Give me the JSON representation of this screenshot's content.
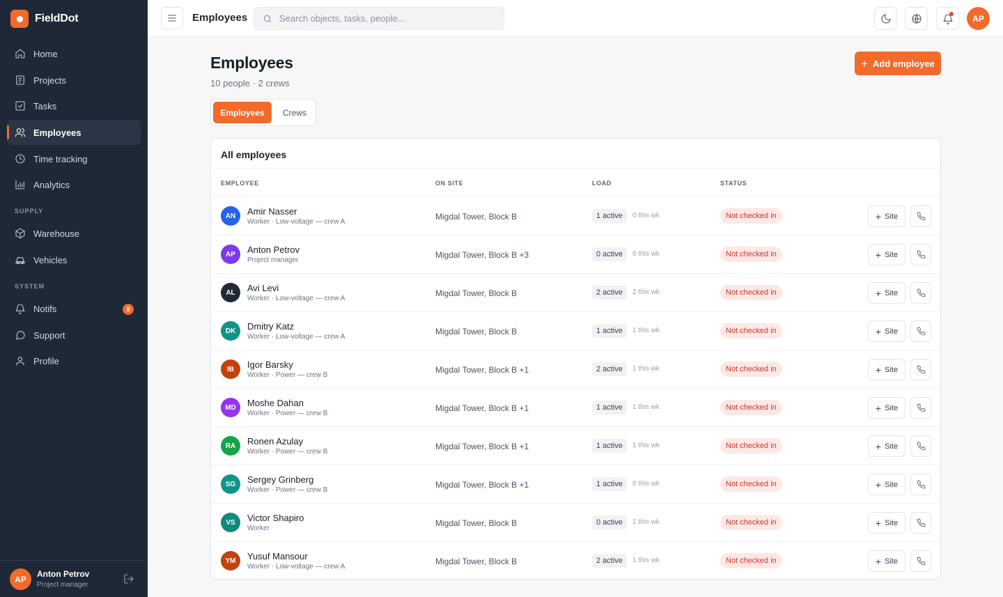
{
  "app": {
    "name": "FieldDot"
  },
  "colors": {
    "accent": "#f26b2b",
    "sidebar_bg": "#1e2836",
    "status_danger_bg": "#fde8e6",
    "status_danger_text": "#c7382c"
  },
  "sidebar": {
    "items": [
      {
        "label": "Home",
        "icon": "home-icon"
      },
      {
        "label": "Projects",
        "icon": "projects-icon"
      },
      {
        "label": "Tasks",
        "icon": "tasks-icon"
      },
      {
        "label": "Employees",
        "icon": "users-icon",
        "active": true
      },
      {
        "label": "Time tracking",
        "icon": "clock-icon"
      },
      {
        "label": "Analytics",
        "icon": "chart-icon"
      }
    ],
    "supply_label": "SUPPLY",
    "supply_items": [
      {
        "label": "Warehouse",
        "icon": "box-icon"
      },
      {
        "label": "Vehicles",
        "icon": "car-icon"
      }
    ],
    "system_label": "SYSTEM",
    "system_items": [
      {
        "label": "Notifs",
        "icon": "bell-icon",
        "badge": "8"
      },
      {
        "label": "Support",
        "icon": "chat-icon"
      },
      {
        "label": "Profile",
        "icon": "user-icon"
      }
    ],
    "user": {
      "initials": "AP",
      "name": "Anton Petrov",
      "role": "Project manager"
    }
  },
  "topbar": {
    "title": "Employees",
    "search_placeholder": "Search objects, tasks, people...",
    "avatar_initials": "AP"
  },
  "page": {
    "title": "Employees",
    "subtitle": "10 people · 2 crews",
    "add_button": "Add employee",
    "tabs": [
      {
        "label": "Employees",
        "active": true
      },
      {
        "label": "Crews"
      }
    ]
  },
  "table": {
    "title": "All employees",
    "columns": [
      "EMPLOYEE",
      "ON SITE",
      "LOAD",
      "STATUS"
    ],
    "site_button": "Site",
    "rows": [
      {
        "initials": "AN",
        "color": "#2563eb",
        "name": "Amir Nasser",
        "role": "Worker · Low-voltage — crew A",
        "site": "Migdal Tower, Block B",
        "active": "1 active",
        "week": "0 this wk",
        "status": "Not checked in"
      },
      {
        "initials": "AP",
        "color": "#7c3aed",
        "name": "Anton Petrov",
        "role": "Project manager",
        "site": "Migdal Tower, Block B +3",
        "active": "0 active",
        "week": "0 this wk",
        "status": "Not checked in"
      },
      {
        "initials": "AL",
        "color": "#1f2937",
        "name": "Avi Levi",
        "role": "Worker · Low-voltage — crew A",
        "site": "Migdal Tower, Block B",
        "active": "2 active",
        "week": "2 this wk",
        "status": "Not checked in"
      },
      {
        "initials": "DK",
        "color": "#0d9488",
        "name": "Dmitry Katz",
        "role": "Worker · Low-voltage — crew A",
        "site": "Migdal Tower, Block B",
        "active": "1 active",
        "week": "1 this wk",
        "status": "Not checked in"
      },
      {
        "initials": "IB",
        "color": "#c2410c",
        "name": "Igor Barsky",
        "role": "Worker · Power — crew B",
        "site": "Migdal Tower, Block B +1",
        "active": "2 active",
        "week": "1 this wk",
        "status": "Not checked in"
      },
      {
        "initials": "MD",
        "color": "#9333ea",
        "name": "Moshe Dahan",
        "role": "Worker · Power — crew B",
        "site": "Migdal Tower, Block B +1",
        "active": "1 active",
        "week": "1 this wk",
        "status": "Not checked in"
      },
      {
        "initials": "RA",
        "color": "#16a34a",
        "name": "Ronen Azulay",
        "role": "Worker · Power — crew B",
        "site": "Migdal Tower, Block B +1",
        "active": "1 active",
        "week": "1 this wk",
        "status": "Not checked in"
      },
      {
        "initials": "SG",
        "color": "#0f9488",
        "name": "Sergey Grinberg",
        "role": "Worker · Power — crew B",
        "site": "Migdal Tower, Block B +1",
        "active": "1 active",
        "week": "0 this wk",
        "status": "Not checked in"
      },
      {
        "initials": "VS",
        "color": "#0f8a7a",
        "name": "Victor Shapiro",
        "role": "Worker",
        "site": "Migdal Tower, Block B",
        "active": "0 active",
        "week": "1 this wk",
        "status": "Not checked in"
      },
      {
        "initials": "YM",
        "color": "#c2410c",
        "name": "Yusuf Mansour",
        "role": "Worker · Low-voltage — crew A",
        "site": "Migdal Tower, Block B",
        "active": "2 active",
        "week": "1 this wk",
        "status": "Not checked in"
      }
    ]
  }
}
